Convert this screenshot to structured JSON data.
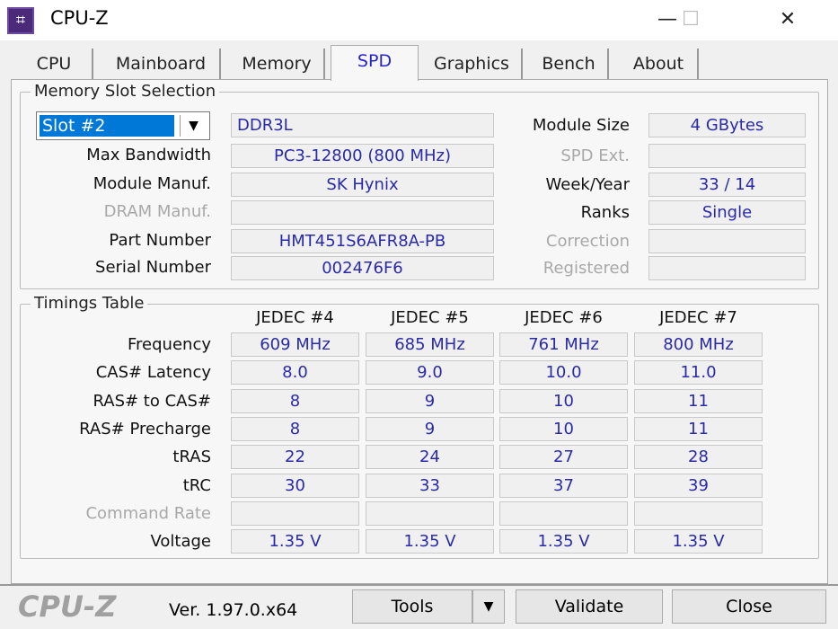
{
  "window": {
    "title": "CPU-Z",
    "minimize": "—",
    "maximize": "☐",
    "close": "✕",
    "icon": "cpu-z-app-icon"
  },
  "tabs": [
    {
      "label": "CPU"
    },
    {
      "label": "Mainboard"
    },
    {
      "label": "Memory"
    },
    {
      "label": "SPD",
      "active": true
    },
    {
      "label": "Graphics"
    },
    {
      "label": "Bench"
    },
    {
      "label": "About"
    }
  ],
  "slot_section": {
    "title": "Memory Slot Selection",
    "slot_selected": "Slot #2",
    "memory_type": "DDR3L",
    "left_rows": [
      {
        "label": "Max Bandwidth",
        "value": "PC3-12800 (800 MHz)",
        "enabled": true
      },
      {
        "label": "Module Manuf.",
        "value": "SK Hynix",
        "enabled": true
      },
      {
        "label": "DRAM Manuf.",
        "value": "",
        "enabled": false
      },
      {
        "label": "Part Number",
        "value": "HMT451S6AFR8A-PB",
        "enabled": true
      },
      {
        "label": "Serial Number",
        "value": "002476F6",
        "enabled": true
      }
    ],
    "right_rows": [
      {
        "label": "Module Size",
        "value": "4 GBytes",
        "enabled": true
      },
      {
        "label": "SPD Ext.",
        "value": "",
        "enabled": false
      },
      {
        "label": "Week/Year",
        "value": "33 / 14",
        "enabled": true
      },
      {
        "label": "Ranks",
        "value": "Single",
        "enabled": true
      },
      {
        "label": "Correction",
        "value": "",
        "enabled": false
      },
      {
        "label": "Registered",
        "value": "",
        "enabled": false
      }
    ]
  },
  "timings": {
    "title": "Timings Table",
    "columns": [
      "JEDEC #4",
      "JEDEC #5",
      "JEDEC #6",
      "JEDEC #7"
    ],
    "rows": [
      {
        "label": "Frequency",
        "values": [
          "609 MHz",
          "685 MHz",
          "761 MHz",
          "800 MHz"
        ],
        "enabled": true
      },
      {
        "label": "CAS# Latency",
        "values": [
          "8.0",
          "9.0",
          "10.0",
          "11.0"
        ],
        "enabled": true
      },
      {
        "label": "RAS# to CAS#",
        "values": [
          "8",
          "9",
          "10",
          "11"
        ],
        "enabled": true
      },
      {
        "label": "RAS# Precharge",
        "values": [
          "8",
          "9",
          "10",
          "11"
        ],
        "enabled": true
      },
      {
        "label": "tRAS",
        "values": [
          "22",
          "24",
          "27",
          "28"
        ],
        "enabled": true
      },
      {
        "label": "tRC",
        "values": [
          "30",
          "33",
          "37",
          "39"
        ],
        "enabled": true
      },
      {
        "label": "Command Rate",
        "values": [
          "",
          "",
          "",
          ""
        ],
        "enabled": false
      },
      {
        "label": "Voltage",
        "values": [
          "1.35 V",
          "1.35 V",
          "1.35 V",
          "1.35 V"
        ],
        "enabled": true
      }
    ]
  },
  "footer": {
    "logo": "CPU-Z",
    "version": "Ver. 1.97.0.x64",
    "tools": "Tools",
    "tools_arrow": "▼",
    "validate": "Validate",
    "close": "Close"
  }
}
